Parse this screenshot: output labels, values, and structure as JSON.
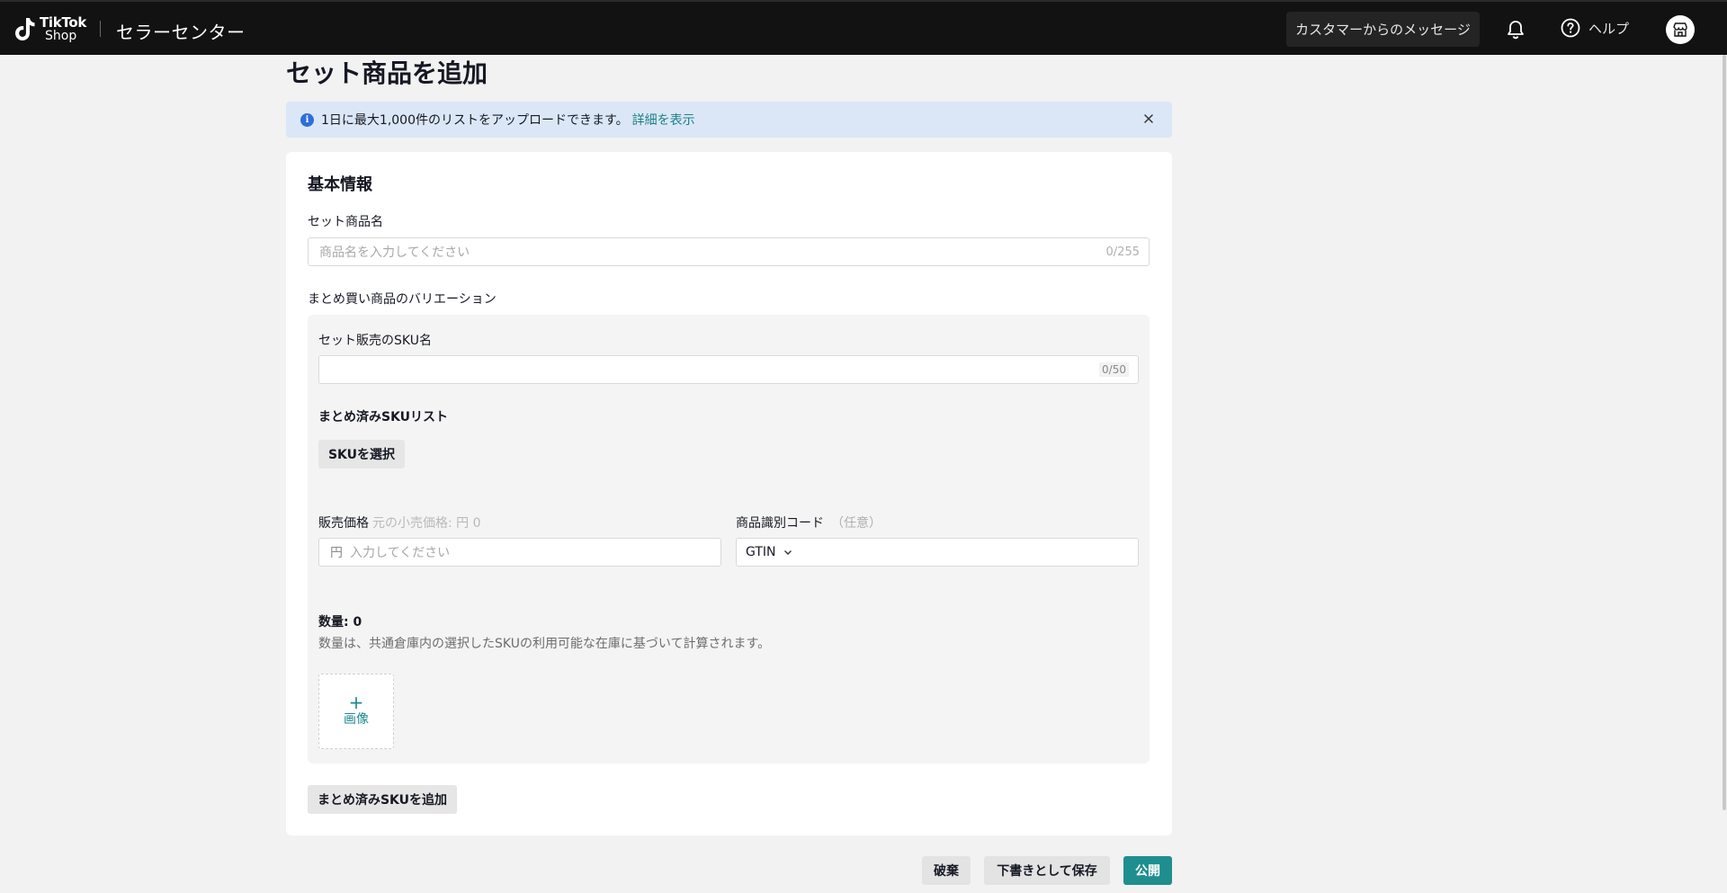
{
  "header": {
    "logo_line1": "TikTok",
    "logo_line2": "Shop",
    "app_title": "セラーセンター",
    "messages_label": "カスタマーからのメッセージ",
    "help_label": "ヘルプ",
    "icons": [
      "tiktok-logo-icon",
      "bell-icon",
      "help-icon",
      "store-icon"
    ]
  },
  "page": {
    "title": "セット商品を追加"
  },
  "banner": {
    "text": "1日に最大1,000件のリストをアップロードできます。",
    "link": "詳細を表示"
  },
  "basic": {
    "section_title": "基本情報",
    "name_label": "セット商品名",
    "name_placeholder": "商品名を入力してください",
    "name_counter": "0/255",
    "variation_label": "まとめ買い商品のバリエーション",
    "sku_name_label": "セット販売のSKU名",
    "sku_name_counter": "0/50",
    "sku_list_label": "まとめ済みSKUリスト",
    "select_sku_button": "SKUを選択",
    "price_label": "販売価格",
    "price_hint": "元の小売価格: 円 0",
    "price_currency": "円",
    "price_placeholder": "入力してください",
    "code_label": "商品識別コード",
    "code_hint": "（任意）",
    "code_type": "GTIN",
    "quantity_title": "数量: 0",
    "quantity_desc": "数量は、共通倉庫内の選択したSKUの利用可能な在庫に基づいて計算されます。",
    "image_plus": "+",
    "image_label": "画像",
    "add_sku_button": "まとめ済みSKUを追加"
  },
  "footer": {
    "discard": "破棄",
    "save_draft": "下書きとして保存",
    "publish": "公開"
  },
  "colors": {
    "topbar": "#121212",
    "accent": "#1f8e8f",
    "banner_bg": "#dbe7f7",
    "info_blue": "#2d6fd9"
  }
}
